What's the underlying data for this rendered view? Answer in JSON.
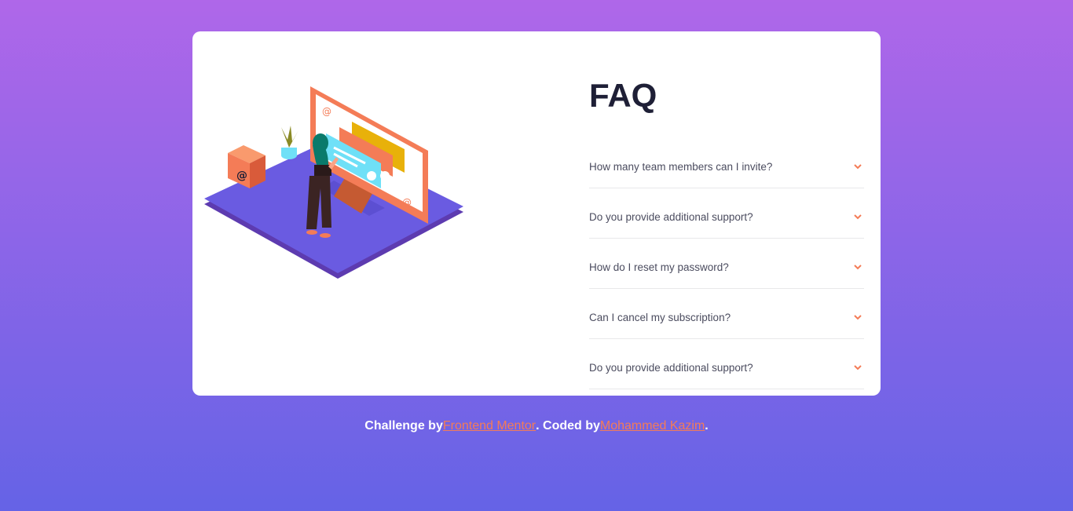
{
  "faq": {
    "title": "FAQ",
    "items": [
      {
        "question": "How many team members can I invite?"
      },
      {
        "question": "Do you provide additional support?"
      },
      {
        "question": "How do I reset my password?"
      },
      {
        "question": "Can I cancel my subscription?"
      },
      {
        "question": "Do you provide additional support?"
      }
    ]
  },
  "footer": {
    "challenge_prefix": "Challenge by",
    "challenge_link": "Frontend Mentor",
    "middle": ". Coded by",
    "author_link": "Mohammed Kazim",
    "suffix": "."
  },
  "colors": {
    "accent": "#f47c57",
    "background_top": "#af67e9",
    "background_bottom": "#6563e6",
    "title": "#1e1f36"
  },
  "icons": {
    "chevron": "chevron-down-icon",
    "illustration": "woman-online-desktop-illustration"
  }
}
